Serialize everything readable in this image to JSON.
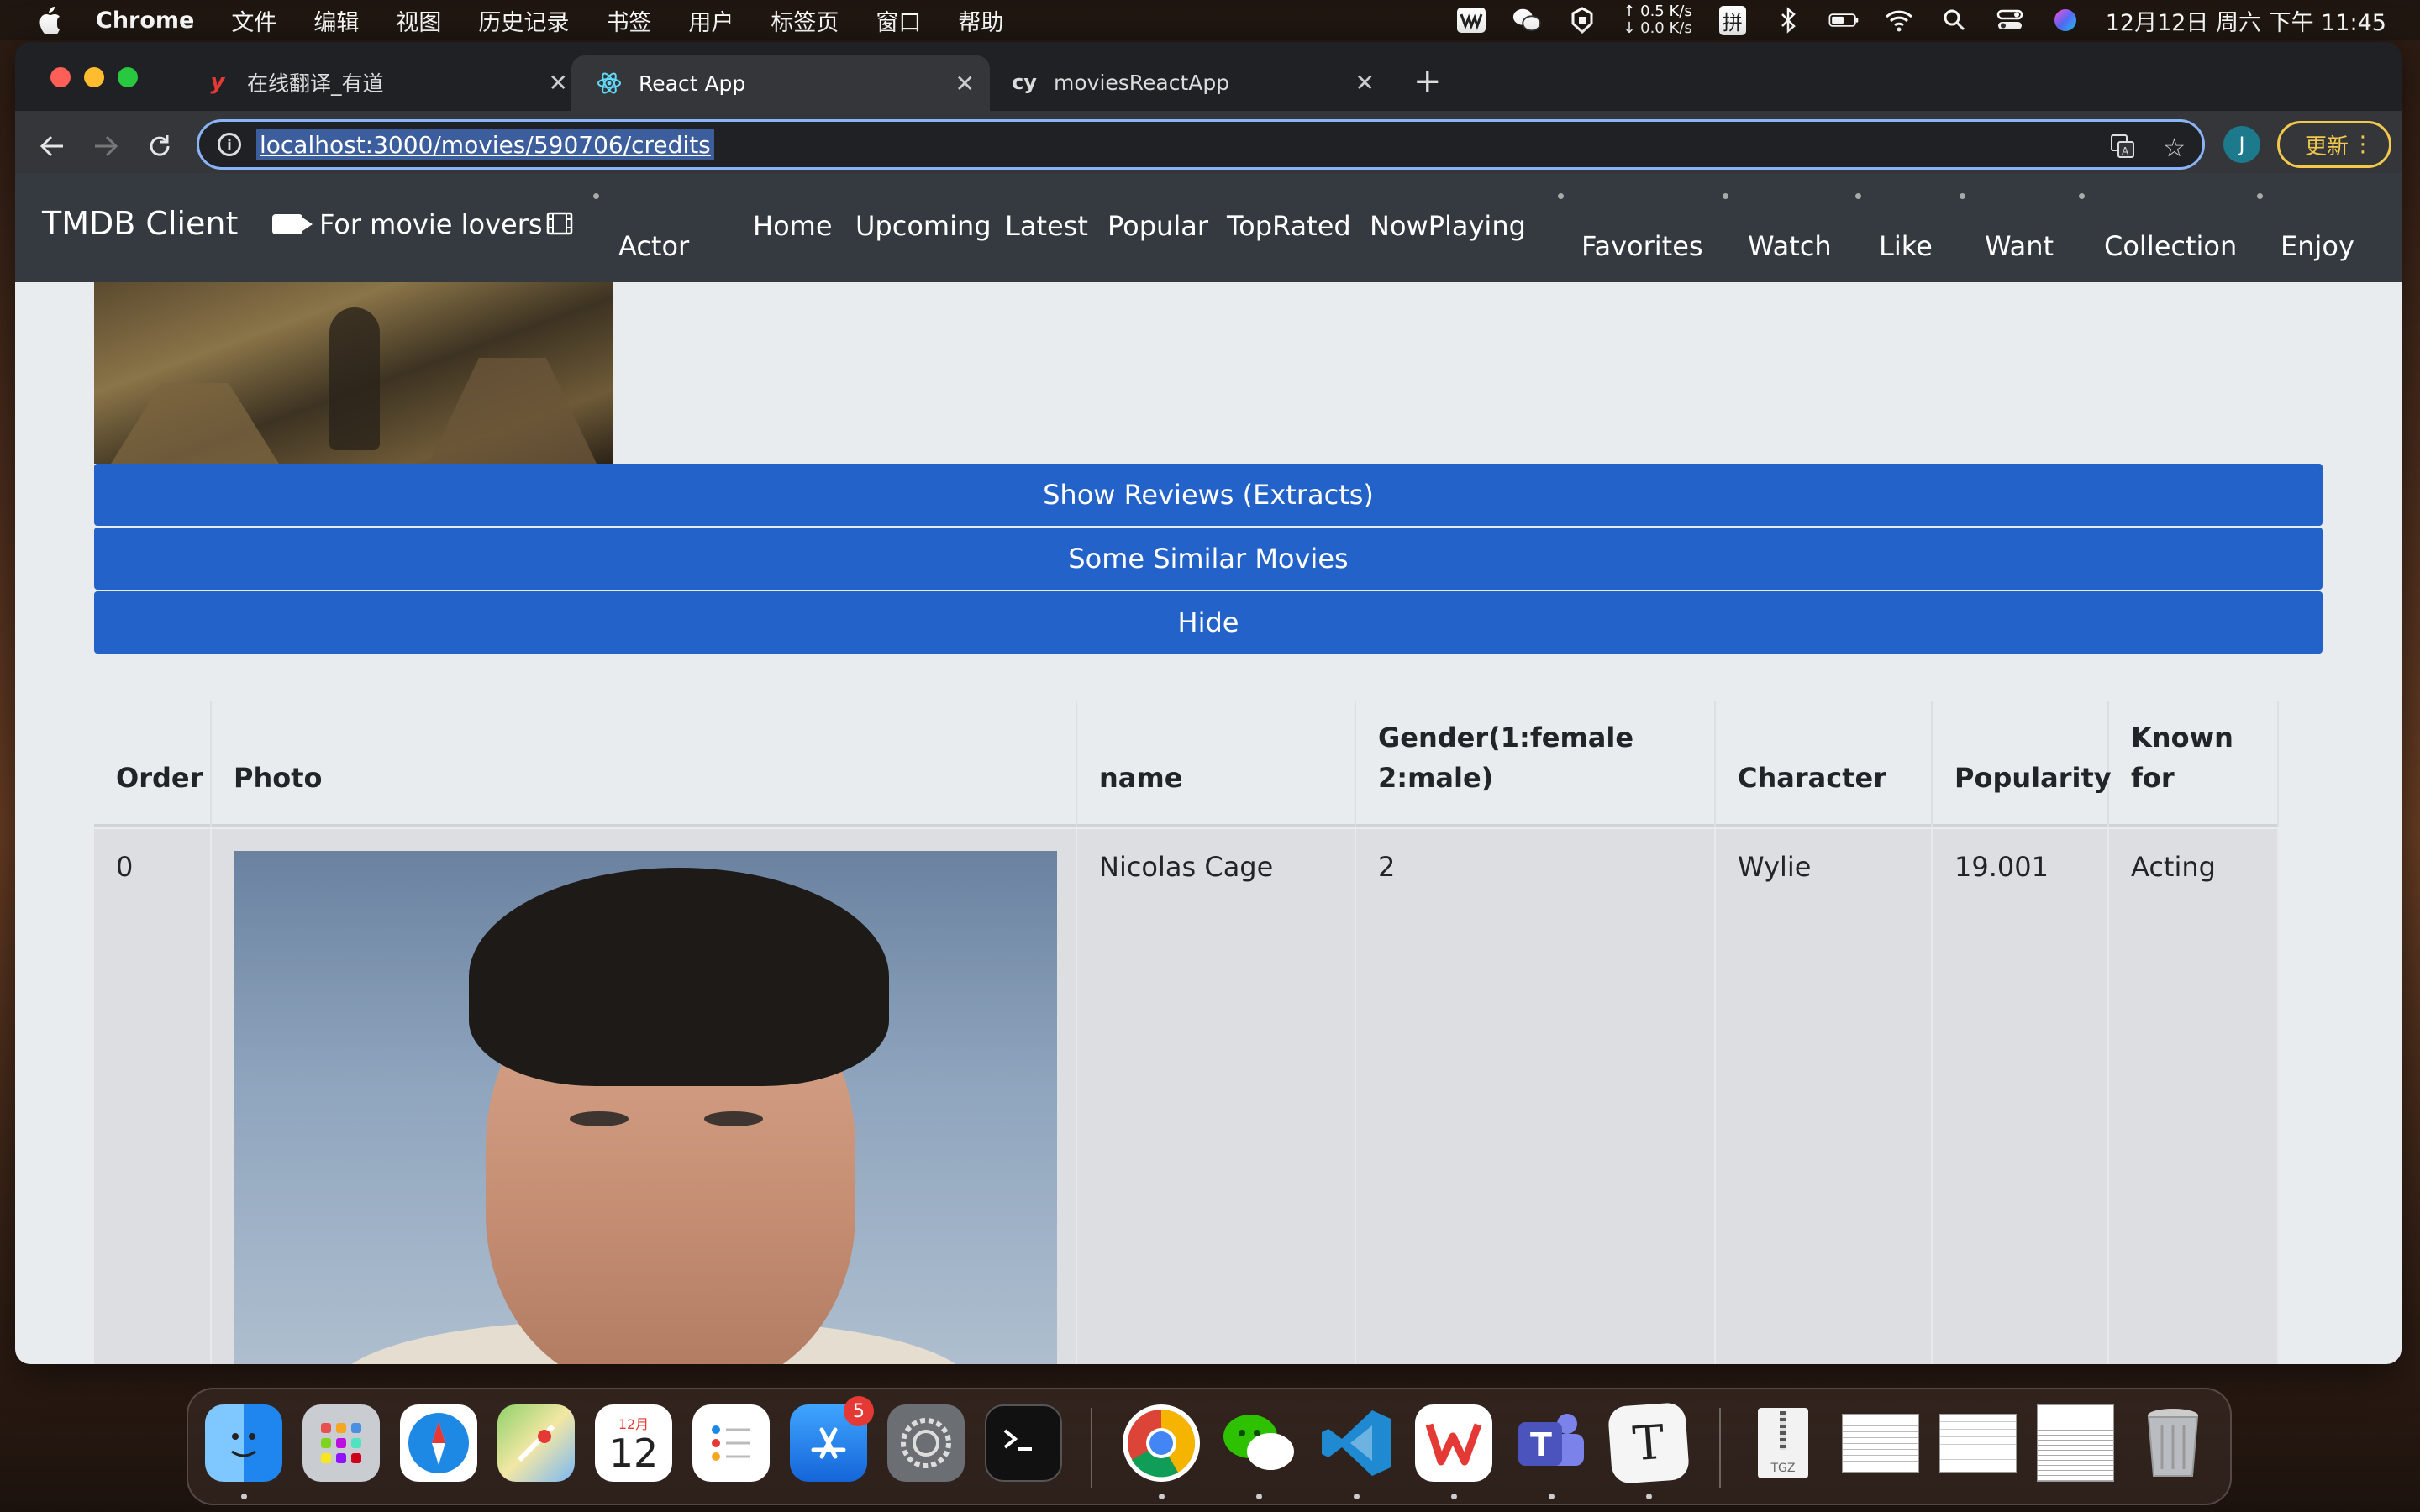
{
  "menubar": {
    "app_name": "Chrome",
    "items": [
      "文件",
      "编辑",
      "视图",
      "历史记录",
      "书签",
      "用户",
      "标签页",
      "窗口",
      "帮助"
    ],
    "net_up": "↑ 0.5 K/s",
    "net_down": "↓ 0.0 K/s",
    "clock": "12月12日 周六 下午 11:45",
    "ime": "拼"
  },
  "browser": {
    "tabs": [
      {
        "title": "在线翻译_有道",
        "favicon": "y"
      },
      {
        "title": "React App",
        "favicon": "react-icon"
      },
      {
        "title": "moviesReactApp",
        "favicon": "cy"
      }
    ],
    "url": "localhost:3000/movies/590706/credits",
    "avatar_letter": "J",
    "update_label": "更新"
  },
  "navbar": {
    "brand": "TMDB Client",
    "tagline": "For movie lovers",
    "links": [
      "Actor",
      "Home",
      "Upcoming",
      "Latest",
      "Popular",
      "TopRated",
      "NowPlaying",
      "Favorites",
      "Watch",
      "Like",
      "Want",
      "Collection",
      "Enjoy"
    ]
  },
  "buttons": {
    "reviews": "Show Reviews (Extracts)",
    "similar": "Some Similar Movies",
    "hide": "Hide"
  },
  "table": {
    "headers": [
      "Order",
      "Photo",
      "name",
      "Gender(1:female 2:male)",
      "Character",
      "Popularity",
      "Known for"
    ],
    "rows": [
      {
        "order": "0",
        "name": "Nicolas Cage",
        "gender": "2",
        "character": "Wylie",
        "popularity": "19.001",
        "known_for": "Acting"
      }
    ]
  },
  "dock": {
    "calendar_month": "12月",
    "calendar_day": "12",
    "appstore_badge": "5",
    "textedit_letter": "T",
    "archive_label": "TGZ"
  }
}
